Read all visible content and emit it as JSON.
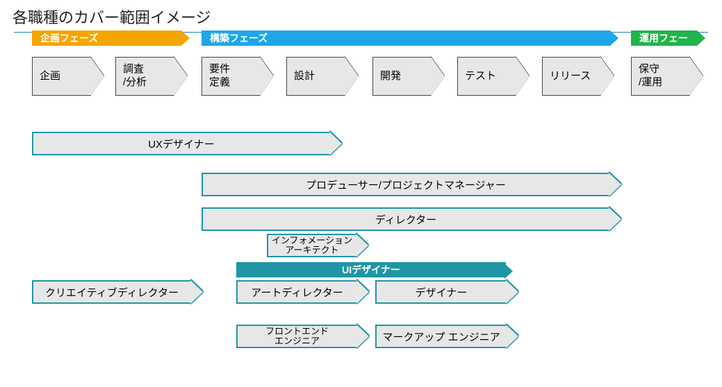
{
  "title": "各職種のカバー範囲イメージ",
  "phases": {
    "plan": "企画フェーズ",
    "build": "構築フェーズ",
    "operate": "運用フェーズ"
  },
  "stages": {
    "s1": "企画",
    "s2": "調査\n/分析",
    "s3": "要件\n定義",
    "s4": "設計",
    "s5": "開発",
    "s6": "テスト",
    "s7": "リリース",
    "s8": "保守\n/運用"
  },
  "roles": {
    "ux": "UXデザイナー",
    "pm": "プロデューサー/プロジェクトマネージャー",
    "director": "ディレクター",
    "ia": "インフォメーション\nアーキテクト",
    "cd": "クリエイティブディレクター",
    "ui": "UIデザイナー",
    "ad": "アートディレクター",
    "designer": "デザイナー",
    "fe": "フロントエンド\nエンジニア",
    "markup": "マークアップ エンジニア"
  }
}
